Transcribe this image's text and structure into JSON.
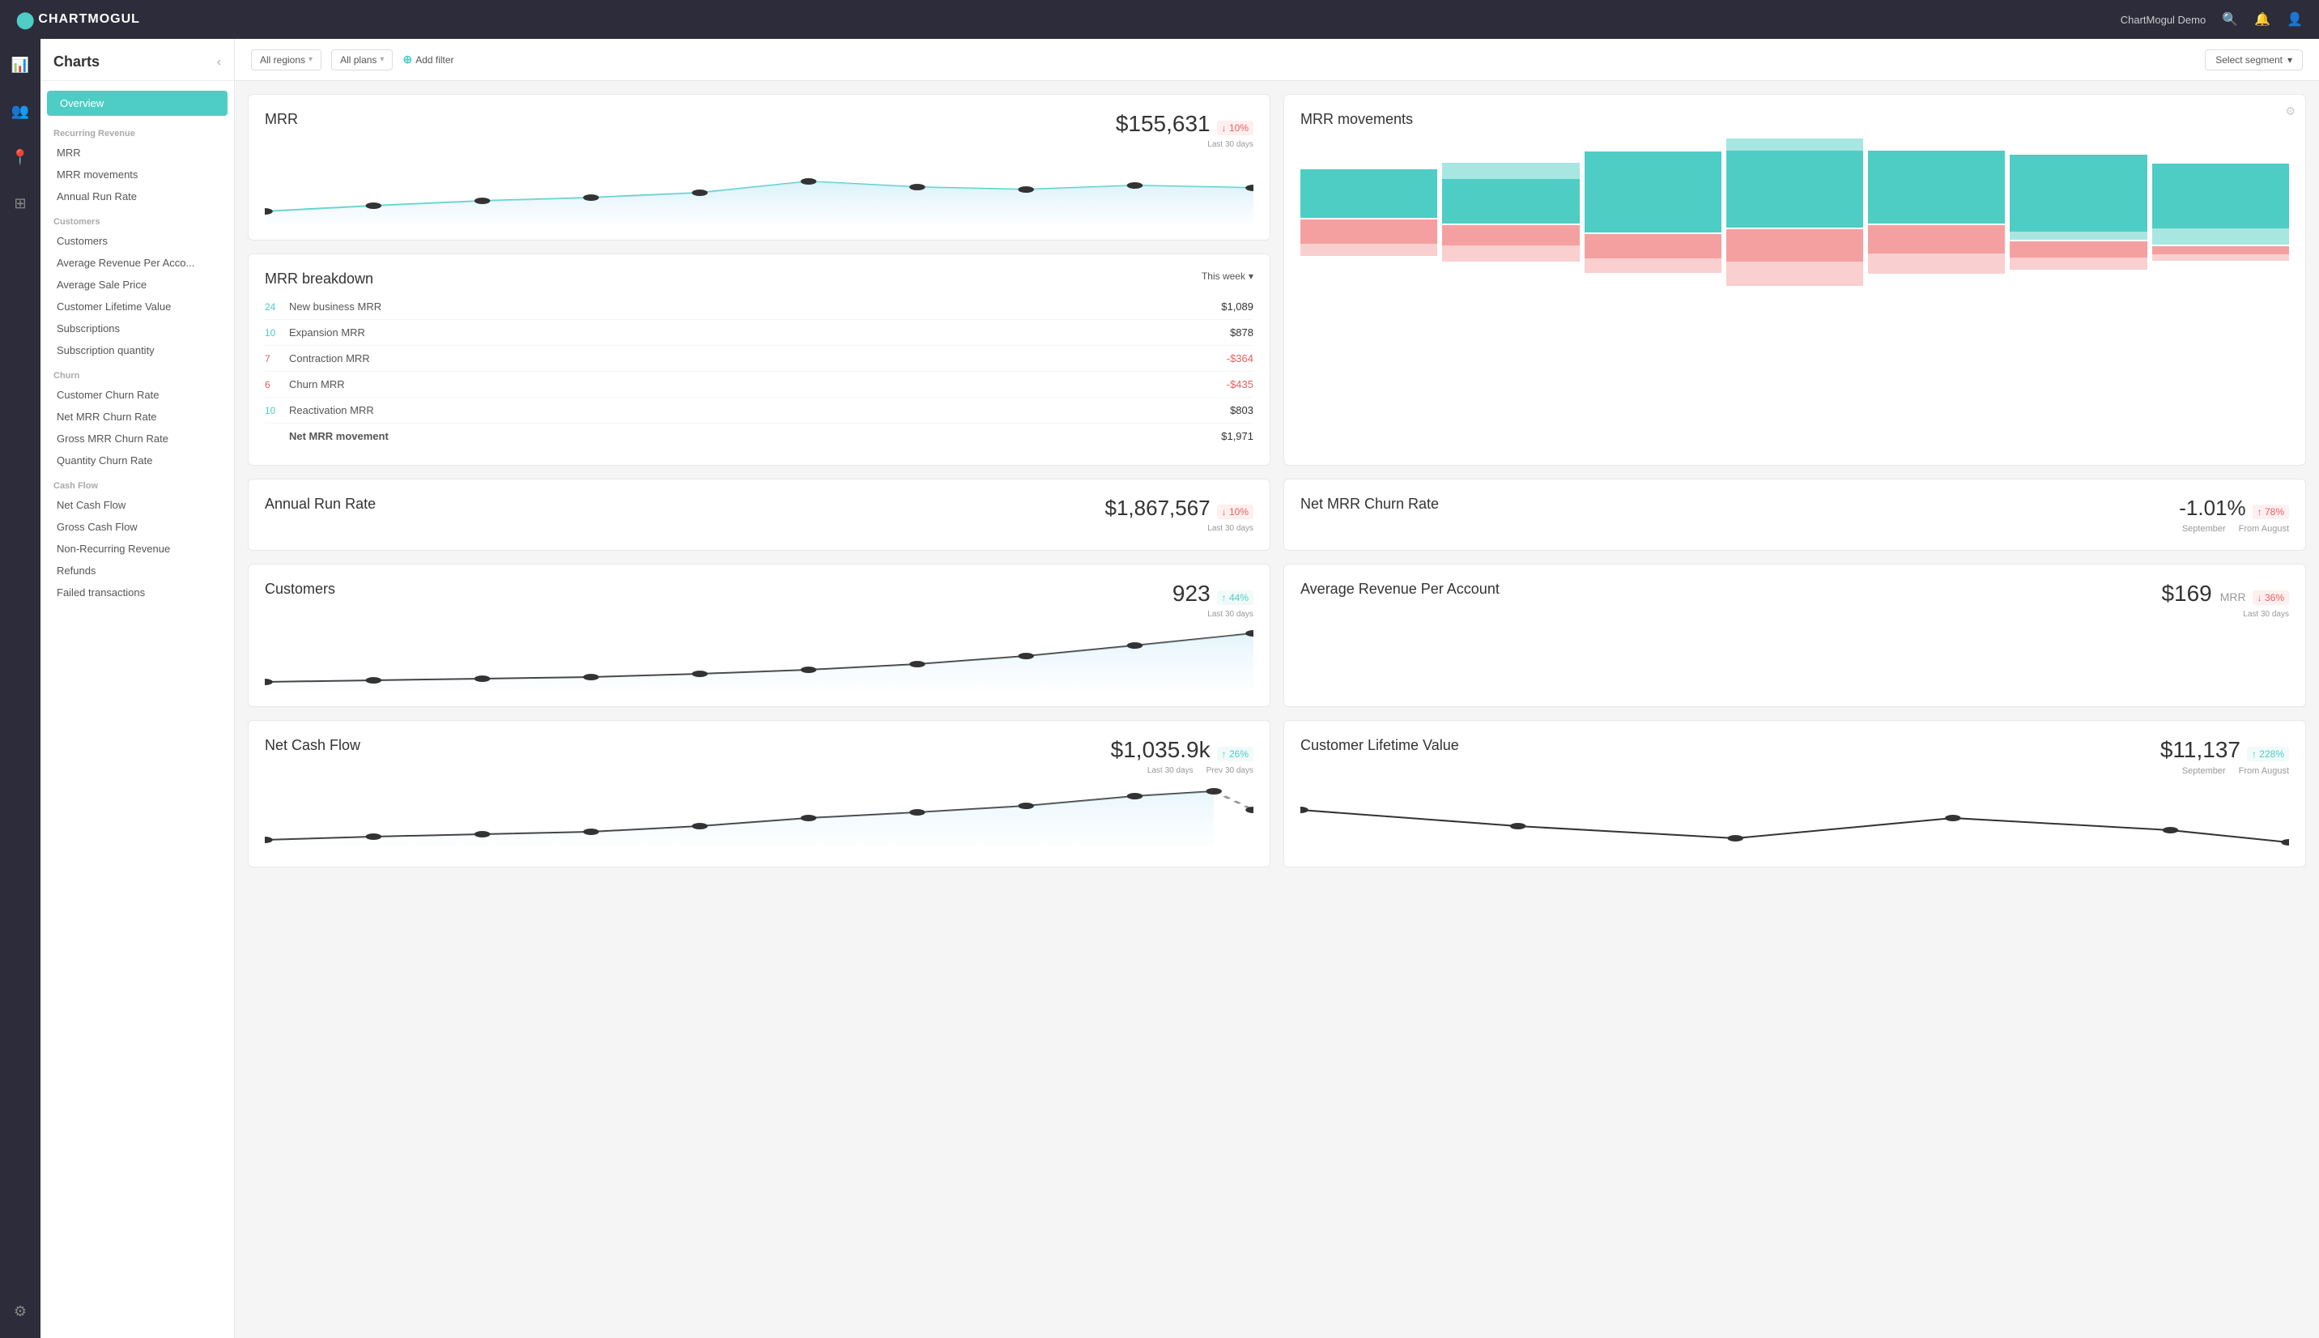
{
  "topnav": {
    "logo": "CHARTMOGUL",
    "user": "ChartMogul Demo",
    "icons": [
      "search",
      "bell",
      "user"
    ]
  },
  "sidebar": {
    "title": "Charts",
    "active": "Overview",
    "sections": [
      {
        "label": "Recurring Revenue",
        "items": [
          "MRR",
          "MRR movements",
          "Annual Run Rate"
        ]
      },
      {
        "label": "Customers",
        "items": [
          "Customers",
          "Average Revenue Per Acco...",
          "Average Sale Price",
          "Customer Lifetime Value",
          "Subscriptions",
          "Subscription quantity"
        ]
      },
      {
        "label": "Churn",
        "items": [
          "Customer Churn Rate",
          "Net MRR Churn Rate",
          "Gross MRR Churn Rate",
          "Quantity Churn Rate"
        ]
      },
      {
        "label": "Cash Flow",
        "items": [
          "Net Cash Flow",
          "Gross Cash Flow",
          "Non-Recurring Revenue",
          "Refunds",
          "Failed transactions"
        ]
      }
    ]
  },
  "filters": {
    "regions": "All regions",
    "plans": "All plans",
    "add_filter": "Add filter",
    "segment": "Select segment"
  },
  "cards": {
    "mrr": {
      "title": "MRR",
      "value": "$155,631",
      "badge": "↓ 10%",
      "badge_type": "red",
      "sub": "Last 30 days"
    },
    "mrr_breakdown": {
      "title": "MRR breakdown",
      "period": "This week",
      "rows": [
        {
          "num": "24",
          "num_color": "teal",
          "label": "New business MRR",
          "value": "$1,089",
          "negative": false
        },
        {
          "num": "10",
          "num_color": "teal",
          "label": "Expansion MRR",
          "value": "$878",
          "negative": false
        },
        {
          "num": "7",
          "num_color": "red",
          "label": "Contraction MRR",
          "value": "-$364",
          "negative": true
        },
        {
          "num": "6",
          "num_color": "red",
          "label": "Churn MRR",
          "value": "-$435",
          "negative": true
        },
        {
          "num": "10",
          "num_color": "teal",
          "label": "Reactivation MRR",
          "value": "$803",
          "negative": false
        },
        {
          "num": "",
          "num_color": "",
          "label": "Net MRR movement",
          "value": "$1,971",
          "negative": false
        }
      ]
    },
    "net_mrr_churn": {
      "title": "Net MRR Churn Rate",
      "value": "-1.01%",
      "sub": "September",
      "badge": "↑ 78%",
      "badge_type": "red",
      "badge_sub": "From August"
    },
    "arpa": {
      "title": "Average Revenue Per Account",
      "value": "$169",
      "unit": "MRR",
      "badge": "↓ 36%",
      "badge_type": "red",
      "sub": "Last 30 days"
    },
    "ltv": {
      "title": "Customer Lifetime Value",
      "value": "$11,137",
      "sub": "September",
      "badge": "↑ 228%",
      "badge_type": "green",
      "badge_sub": "From August"
    },
    "mrr_movements": {
      "title": "MRR movements"
    },
    "annual_run_rate": {
      "title": "Annual Run Rate",
      "value": "$1,867,567",
      "badge": "↓ 10%",
      "badge_type": "red",
      "sub": "Last 30 days"
    },
    "customers": {
      "title": "Customers",
      "value": "923",
      "badge": "↑ 44%",
      "badge_type": "green",
      "sub": "Last 30 days"
    },
    "net_cash_flow": {
      "title": "Net Cash Flow",
      "value": "$1,035.9k",
      "sub": "Last 30 days",
      "badge": "↑ 26%",
      "badge_type": "green",
      "badge_sub": "Prev 30 days"
    }
  }
}
